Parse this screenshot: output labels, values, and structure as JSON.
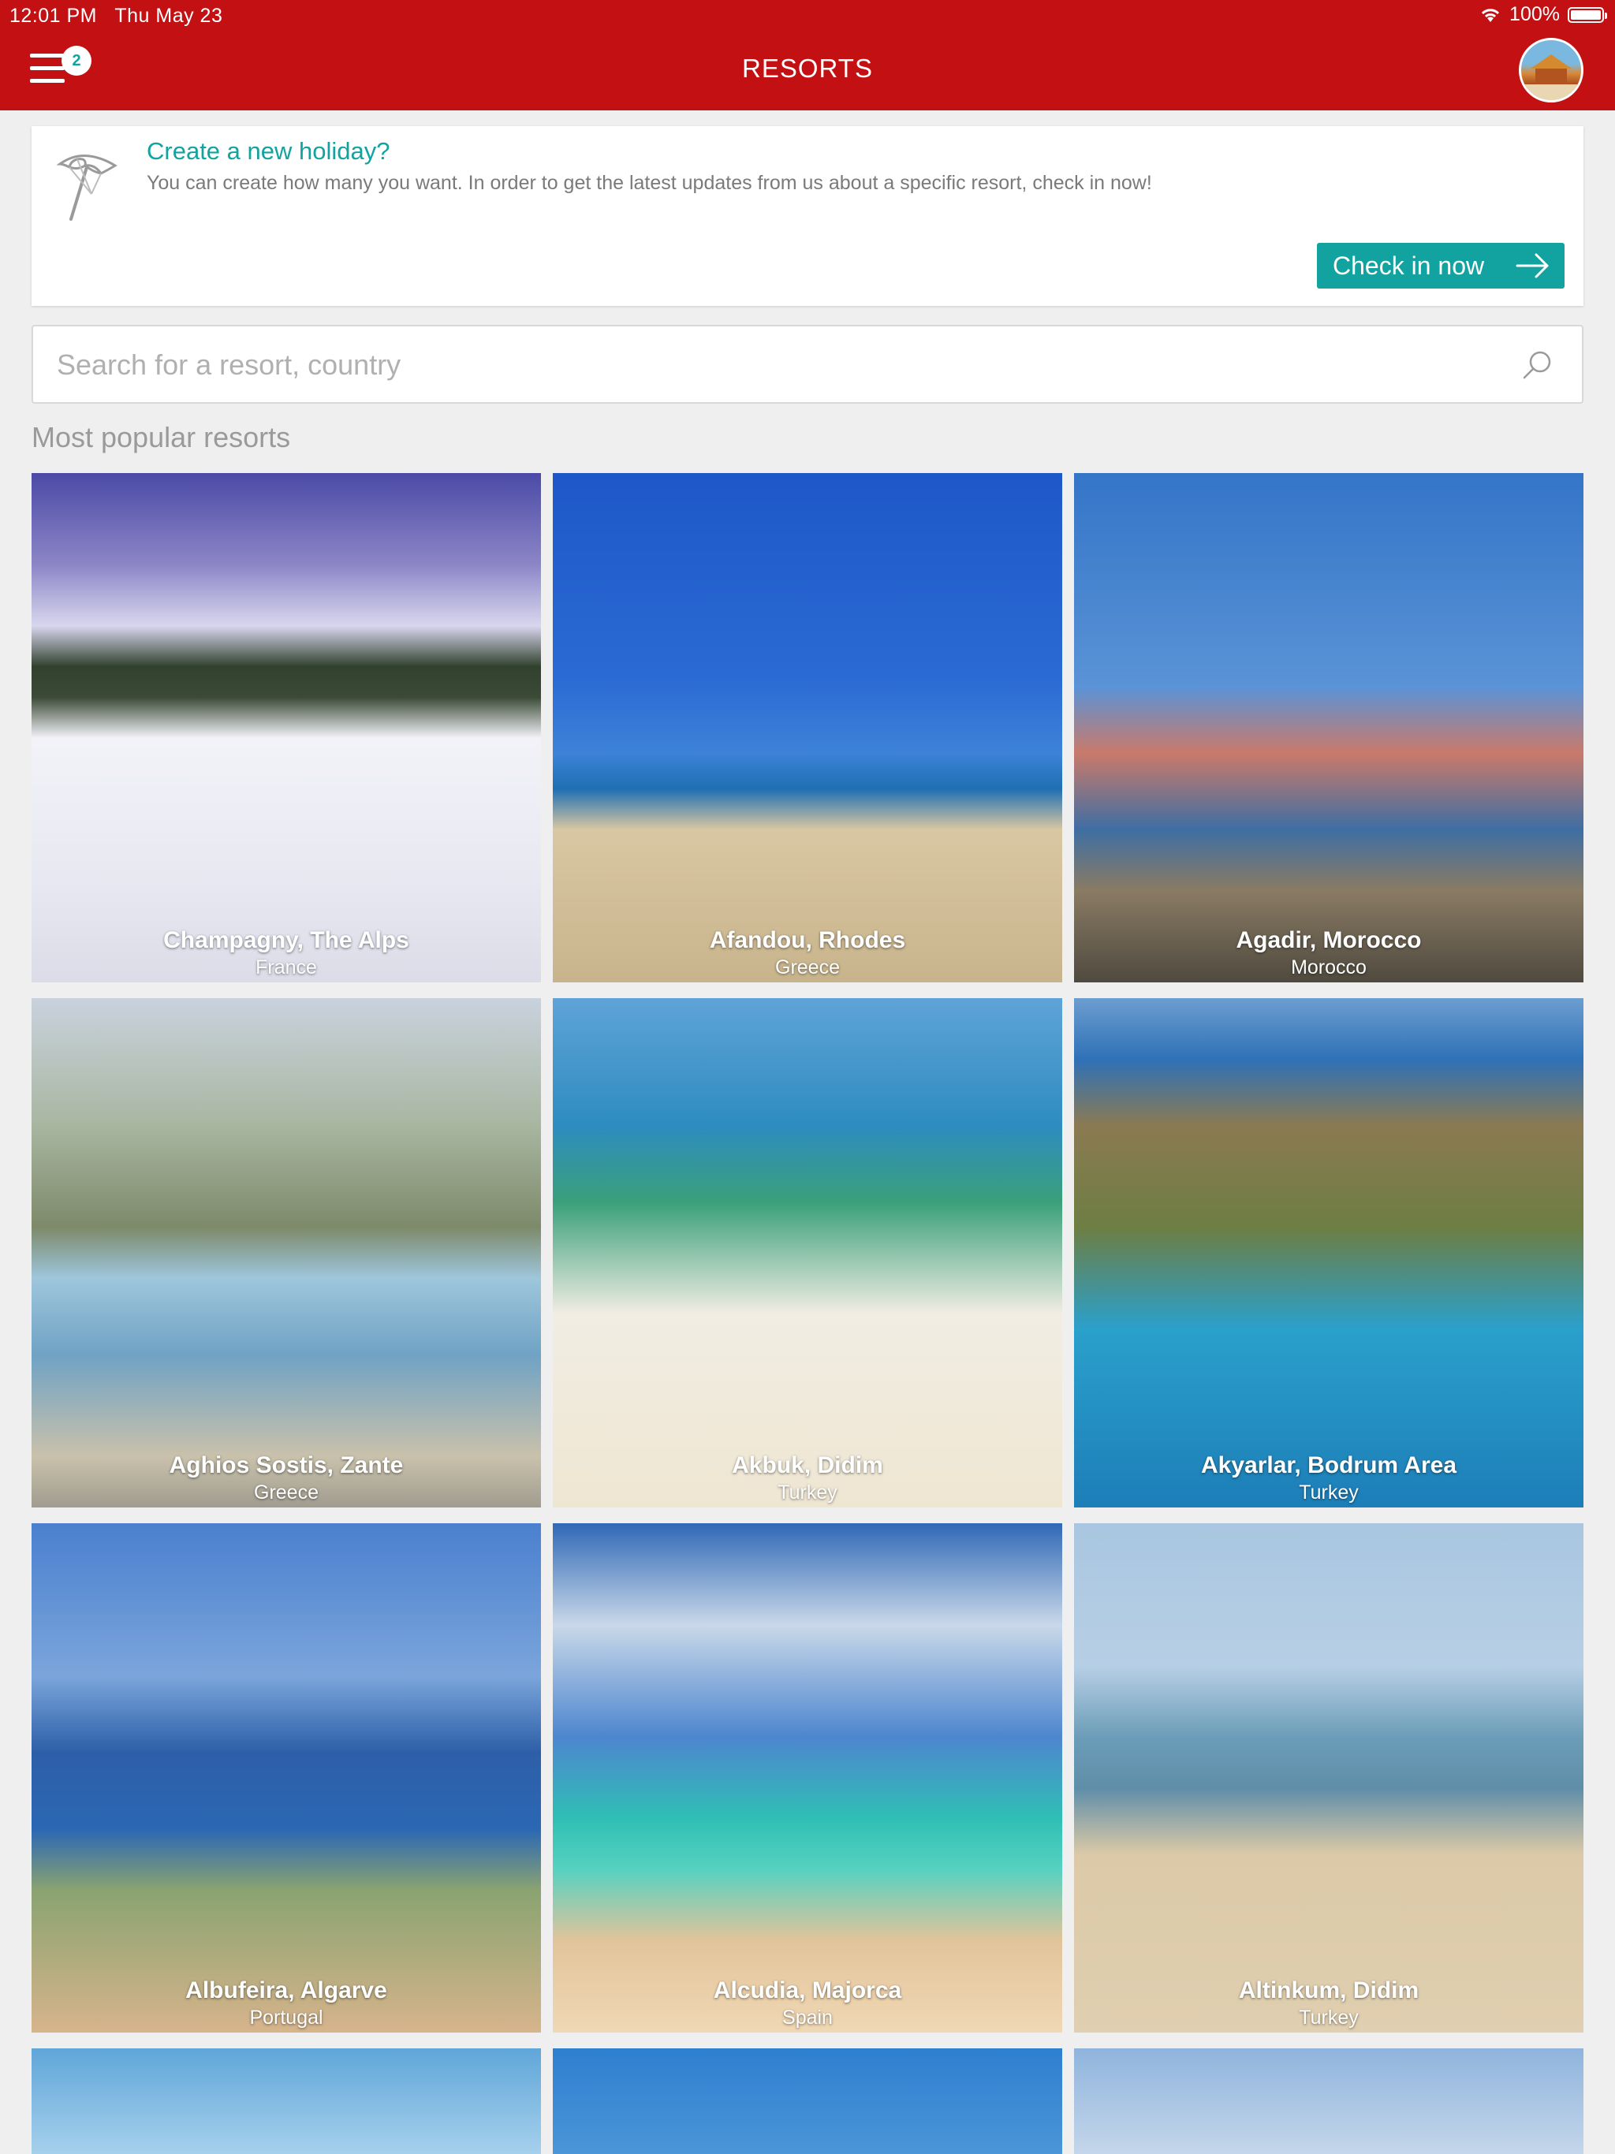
{
  "status_bar": {
    "time": "12:01 PM",
    "date": "Thu May 23",
    "battery": "100%"
  },
  "nav": {
    "title": "RESORTS",
    "menu_badge": "2"
  },
  "promo": {
    "title": "Create a new holiday?",
    "text": "You can create how many you want. In order to get the latest updates from us about a specific resort, check in now!",
    "button_label": "Check in now"
  },
  "search": {
    "placeholder": "Search for a resort, country",
    "value": ""
  },
  "section_title": "Most popular resorts",
  "resorts": [
    {
      "name": "Champagny, The Alps",
      "country": "France"
    },
    {
      "name": "Afandou, Rhodes",
      "country": "Greece"
    },
    {
      "name": "Agadir, Morocco",
      "country": "Morocco"
    },
    {
      "name": "Aghios Sostis, Zante",
      "country": "Greece"
    },
    {
      "name": "Akbuk, Didim",
      "country": "Turkey"
    },
    {
      "name": "Akyarlar, Bodrum Area",
      "country": "Turkey"
    },
    {
      "name": "Albufeira, Algarve",
      "country": "Portugal"
    },
    {
      "name": "Alcudia, Majorca",
      "country": "Spain"
    },
    {
      "name": "Altinkum, Didim",
      "country": "Turkey"
    }
  ],
  "colors": {
    "brand_red": "#c21013",
    "accent_teal": "#12a3a0",
    "background": "#efefef"
  },
  "icons": {
    "menu": "hamburger-menu-icon",
    "umbrella": "beach-umbrella-icon",
    "arrow": "arrow-right-icon",
    "search": "search-icon",
    "wifi": "wifi-icon",
    "battery": "battery-icon"
  }
}
